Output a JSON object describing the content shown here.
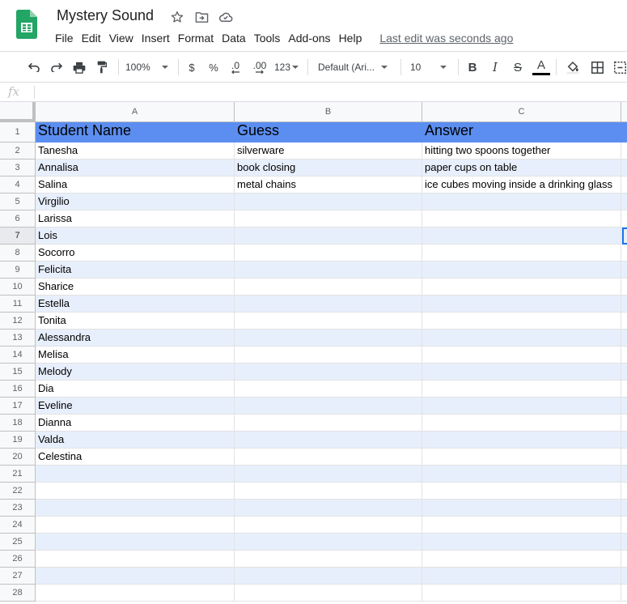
{
  "doc": {
    "title": "Mystery Sound",
    "last_edit": "Last edit was seconds ago"
  },
  "menu": [
    "File",
    "Edit",
    "View",
    "Insert",
    "Format",
    "Data",
    "Tools",
    "Add-ons",
    "Help"
  ],
  "toolbar": {
    "zoom": "100%",
    "currency": "$",
    "percent": "%",
    "decrease_decimals": ".0",
    "increase_decimals": ".00",
    "more_formats": "123",
    "font": "Default (Ari...",
    "font_size": "10",
    "bold": "B",
    "italic": "I",
    "strikethrough": "S",
    "text_color": "A"
  },
  "formula": {
    "fx": "fx"
  },
  "colors": {
    "header_fill": "#5b8ef0",
    "band_fill": "#e8effc",
    "accent": "#1a73e8"
  },
  "sheet": {
    "columns": [
      "A",
      "B",
      "C"
    ],
    "header": [
      "Student Name",
      "Guess",
      "Answer"
    ],
    "rows": [
      [
        "Tanesha",
        "silverware",
        "hitting two spoons together"
      ],
      [
        "Annalisa",
        "book closing",
        "paper cups on table"
      ],
      [
        "Salina",
        "metal chains",
        "ice cubes moving inside a drinking glass"
      ],
      [
        "Virgilio",
        "",
        ""
      ],
      [
        "Larissa",
        "",
        ""
      ],
      [
        "Lois",
        "",
        ""
      ],
      [
        "Socorro",
        "",
        ""
      ],
      [
        "Felicita",
        "",
        ""
      ],
      [
        "Sharice",
        "",
        ""
      ],
      [
        "Estella",
        "",
        ""
      ],
      [
        "Tonita",
        "",
        ""
      ],
      [
        "Alessandra",
        "",
        ""
      ],
      [
        "Melisa",
        "",
        ""
      ],
      [
        "Melody",
        "",
        ""
      ],
      [
        "Dia",
        "",
        ""
      ],
      [
        "Eveline",
        "",
        ""
      ],
      [
        "Dianna",
        "",
        ""
      ],
      [
        "Valda",
        "",
        ""
      ],
      [
        "Celestina",
        "",
        ""
      ],
      [
        "",
        "",
        ""
      ],
      [
        "",
        "",
        ""
      ],
      [
        "",
        "",
        ""
      ],
      [
        "",
        "",
        ""
      ],
      [
        "",
        "",
        ""
      ],
      [
        "",
        "",
        ""
      ],
      [
        "",
        "",
        ""
      ],
      [
        "",
        "",
        ""
      ]
    ],
    "row_numbers": [
      "1",
      "2",
      "3",
      "4",
      "5",
      "6",
      "7",
      "8",
      "9",
      "10",
      "11",
      "12",
      "13",
      "14",
      "15",
      "16",
      "17",
      "18",
      "19",
      "20",
      "21",
      "22",
      "23",
      "24",
      "25",
      "26",
      "27",
      "28"
    ],
    "selected_row": "7"
  }
}
